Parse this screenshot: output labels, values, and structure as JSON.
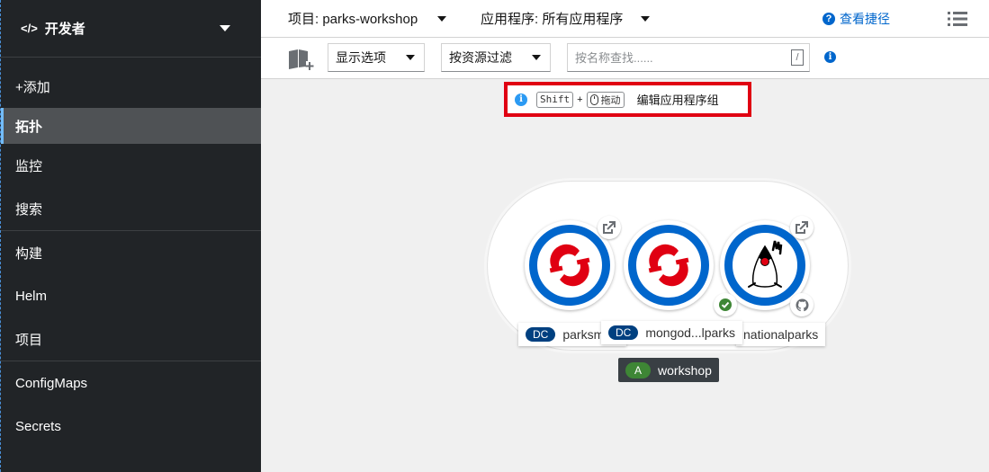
{
  "sidebar": {
    "perspective": "开发者",
    "items": [
      {
        "label": "+添加"
      },
      {
        "label": "拓扑"
      },
      {
        "label": "监控"
      },
      {
        "label": "搜索"
      },
      {
        "label": "构建"
      },
      {
        "label": "Helm"
      },
      {
        "label": "项目"
      },
      {
        "label": "ConfigMaps"
      },
      {
        "label": "Secrets"
      }
    ]
  },
  "topbar": {
    "project": "项目: parks-workshop",
    "application": "应用程序: 所有应用程序",
    "shortcuts": "查看捷径"
  },
  "toolbar": {
    "display_options": "显示选项",
    "filter_by_resource": "按资源过滤",
    "search_placeholder": "按名称查找......",
    "slash_key": "/"
  },
  "hint": {
    "shift_key": "Shift",
    "plus": "+",
    "drag_key": "拖动",
    "text": "编辑应用程序组"
  },
  "topology": {
    "nodes": [
      {
        "badge": "DC",
        "name": "parksmap"
      },
      {
        "badge": "DC",
        "name": "mongod...lparks"
      },
      {
        "name": "nationalparks"
      }
    ],
    "application": {
      "badge": "A",
      "name": "workshop"
    }
  },
  "colors": {
    "sidebar_bg": "#212427",
    "node_ring": "#0066cc",
    "openshift_red": "#e00012",
    "hint_border": "#e00012",
    "status_ok": "#3e8635",
    "app_badge": "#3e8635",
    "dc_badge": "#004080"
  }
}
